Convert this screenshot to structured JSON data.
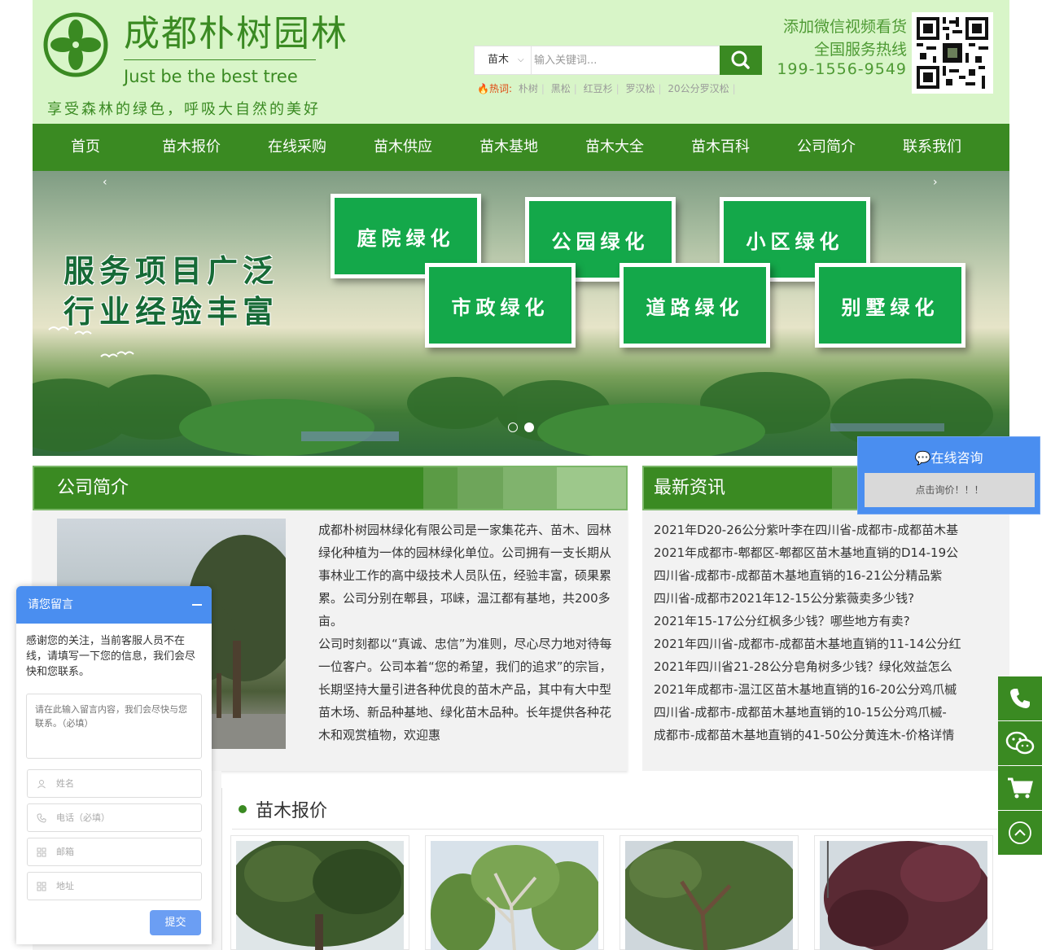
{
  "colors": {
    "brand_green": "#3a8a22",
    "header_bg": "#d8f5c8",
    "widget_blue": "#4a8ef0",
    "hot_red": "#e0470f"
  },
  "header": {
    "brand_name": "成都朴树园林",
    "tagline_en": "Just be the best tree",
    "tagline_cn": "享受森林的绿色，呼吸大自然的美好",
    "wechat_line": "添加微信视频看货",
    "hotline_label": "全国服务热线",
    "phone": "199-1556-9549"
  },
  "search": {
    "category": "苗木",
    "placeholder": "输入关键词...",
    "hot_label": "热词:",
    "hot_words": [
      "朴树",
      "黑松",
      "红豆杉",
      "罗汉松",
      "20公分罗汉松"
    ]
  },
  "nav": [
    "首页",
    "苗木报价",
    "在线采购",
    "苗木供应",
    "苗木基地",
    "苗木大全",
    "苗木百科",
    "公司简介",
    "联系我们"
  ],
  "banner": {
    "headline_line1": "服务项目广泛",
    "headline_line2": "行业经验丰富",
    "boxes": [
      "庭院绿化",
      "公园绿化",
      "小区绿化",
      "市政绿化",
      "道路绿化",
      "别墅绿化"
    ],
    "prev_arrow": "‹",
    "next_arrow": "›",
    "active_slide": 2,
    "slide_count": 2
  },
  "intro": {
    "title": "公司简介",
    "paragraphs": [
      "成都朴树园林绿化有限公司是一家集花卉、苗木、园林绿化种植为一体的园林绿化单位。公司拥有一支长期从事林业工作的高中级技术人员队伍，经验丰富，硕果累累。公司分别在郫县，邛崃，温江都有基地，共200多亩。",
      "公司时刻都以“真诚、忠信”为准则，尽心尽力地对待每一位客户。公司本着“您的希望，我们的追求”的宗旨，长期坚持大量引进各种优良的苗木产品，其中有大中型苗木场、新品种基地、绿化苗木品种。长年提供各种花木和观赏植物，欢迎惠"
    ]
  },
  "news": {
    "title": "最新资讯",
    "items": [
      "2021年D20-26公分紫叶李在四川省-成都市-成都苗木基",
      "2021年成都市-郫都区-郫都区苗木基地直销的D14-19公",
      "四川省-成都市-成都苗木基地直销的16-21公分精品紫",
      "四川省-成都市2021年12-15公分紫薇卖多少钱?",
      "2021年15-17公分红枫多少钱？哪些地方有卖?",
      "2021年四川省-成都市-成都苗木基地直销的11-14公分红",
      "2021年四川省21-28公分皂角树多少钱？绿化效益怎么",
      "2021年成都市-温江区苗木基地直销的16-20公分鸡爪槭",
      "四川省-成都市-成都苗木基地直销的10-15公分鸡爪槭-",
      "成都市-成都苗木基地直销的41-50公分黄连木-价格详情"
    ]
  },
  "products": {
    "title": "苗木报价"
  },
  "consult": {
    "title": "在线咨询",
    "button": "点击询价！！！"
  },
  "message_form": {
    "title": "请您留言",
    "intro": "感谢您的关注，当前客服人员不在线，请填写一下您的信息，我们会尽快和您联系。",
    "content_placeholder": "请在此输入留言内容，我们会尽快与您联系。（必填）",
    "name_placeholder": "姓名",
    "phone_placeholder": "电话（必填）",
    "email_placeholder": "邮箱",
    "address_placeholder": "地址",
    "submit_label": "提交"
  }
}
